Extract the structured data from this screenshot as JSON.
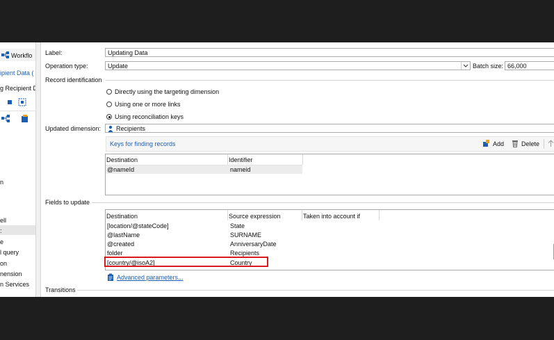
{
  "left_panel": {
    "tab_label": "Workflo",
    "tab2_label": "ipient Data (",
    "tab3_label": "g Recipient D",
    "items": [
      "ell",
      ":",
      "e",
      "l query",
      "on",
      "nension",
      "n Services",
      "n"
    ]
  },
  "form": {
    "label_caption": "Label:",
    "label_value": "Updating Data",
    "operation_caption": "Operation type:",
    "operation_value": "Update",
    "batch_caption": "Batch size:",
    "batch_value": "66,000",
    "record_identification": "Record identification",
    "radio_options": [
      {
        "label": "Directly using the targeting dimension",
        "selected": false
      },
      {
        "label": "Using one or more links",
        "selected": false
      },
      {
        "label": "Using reconciliation keys",
        "selected": true
      }
    ],
    "updated_dimension_caption": "Updated dimension:",
    "updated_dimension_value": "Recipients",
    "keys_link": "Keys for finding records",
    "add_label": "Add",
    "delete_label": "Delete",
    "keys_table": {
      "headers": [
        "Destination",
        "Identifier"
      ],
      "rows": [
        [
          "@nameId",
          "nameid"
        ]
      ]
    },
    "fields_to_update": "Fields to update",
    "fields_table": {
      "headers": [
        "Destination",
        "Source expression",
        "Taken into account if"
      ],
      "rows": [
        [
          "[location/@stateCode]",
          "State"
        ],
        [
          "@lastName",
          "SURNAME"
        ],
        [
          "@created",
          "AnniversaryDate"
        ],
        [
          "folder",
          "Recipients"
        ],
        [
          "[country/@isoA2]",
          "Country"
        ]
      ]
    },
    "advanced_link": "Advanced parameters...",
    "transitions": "Transitions"
  },
  "colors": {
    "accent_blue": "#1a5fb4",
    "highlight_red": "#d9191c",
    "selected_row": "#ececec"
  }
}
